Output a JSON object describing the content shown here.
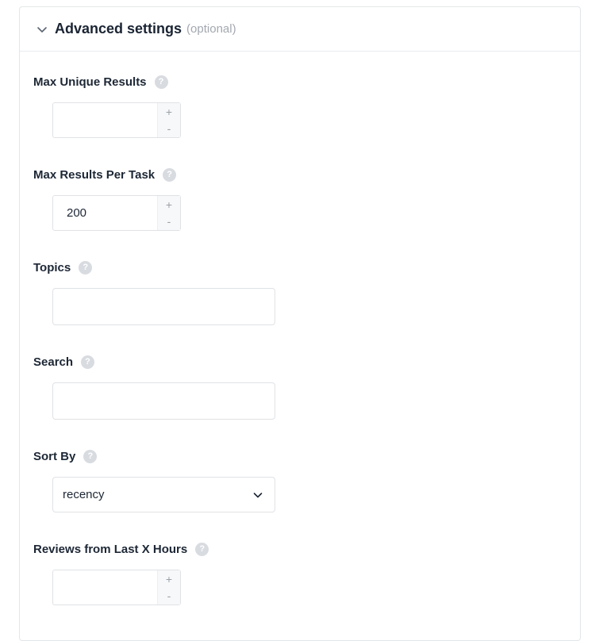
{
  "section": {
    "title": "Advanced settings",
    "optional_label": "(optional)"
  },
  "fields": {
    "max_unique_results": {
      "label": "Max Unique Results",
      "value": ""
    },
    "max_results_per_task": {
      "label": "Max Results Per Task",
      "value": "200"
    },
    "topics": {
      "label": "Topics",
      "value": ""
    },
    "search": {
      "label": "Search",
      "value": ""
    },
    "sort_by": {
      "label": "Sort By",
      "selected": "recency"
    },
    "reviews_last_hours": {
      "label": "Reviews from Last X Hours",
      "value": ""
    }
  },
  "controls": {
    "increment_symbol": "+",
    "decrement_symbol": "-",
    "help_symbol": "?"
  },
  "icons": {
    "collapse": "chevron-down-icon",
    "help": "question-mark-icon",
    "dropdown": "chevron-down-icon"
  },
  "colors": {
    "text": "#1d2735",
    "muted": "#a3a8b0",
    "border": "#dfe2e6",
    "help_badge": "#d8dbe0"
  }
}
